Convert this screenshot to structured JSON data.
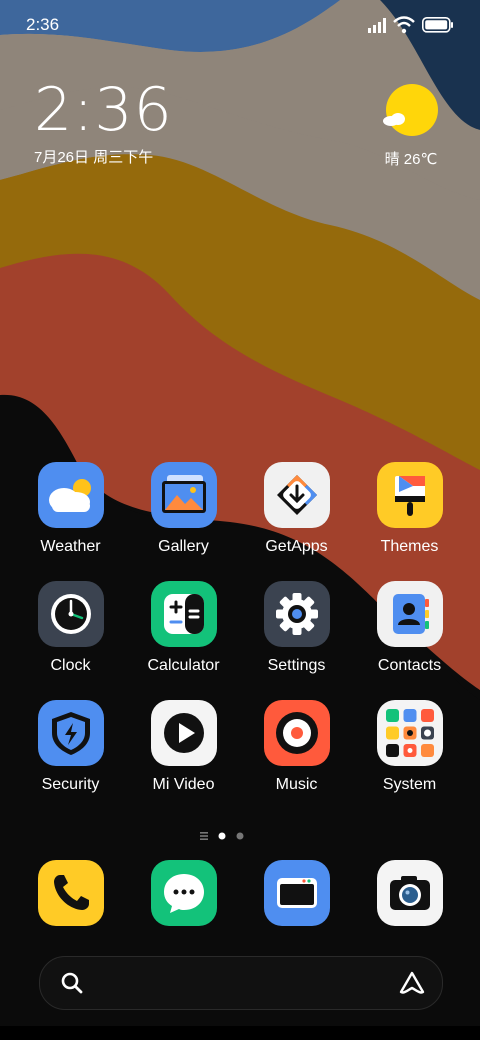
{
  "status_bar": {
    "time": "2:36",
    "icons": [
      "signal-icon",
      "wifi-icon",
      "battery-icon"
    ]
  },
  "clock_widget": {
    "time": "2:36",
    "date": "7月26日 周三下午"
  },
  "weather_widget": {
    "condition_icon": "sunny-icon",
    "text": "晴 26℃"
  },
  "apps": [
    {
      "label": "Weather",
      "icon": "weather-app-icon",
      "bg": "#4f8ef0"
    },
    {
      "label": "Gallery",
      "icon": "gallery-app-icon",
      "bg": "#4f8ef0"
    },
    {
      "label": "GetApps",
      "icon": "getapps-app-icon",
      "bg": "#f1f1f1"
    },
    {
      "label": "Themes",
      "icon": "themes-app-icon",
      "bg": "#ffcb26"
    },
    {
      "label": "Clock",
      "icon": "clock-app-icon",
      "bg": "#3b4350"
    },
    {
      "label": "Calculator",
      "icon": "calculator-app-icon",
      "bg": "#13c27a"
    },
    {
      "label": "Settings",
      "icon": "settings-app-icon",
      "bg": "#3b4350"
    },
    {
      "label": "Contacts",
      "icon": "contacts-app-icon",
      "bg": "#f1f1f1"
    },
    {
      "label": "Security",
      "icon": "security-app-icon",
      "bg": "#4f8ef0"
    },
    {
      "label": "Mi Video",
      "icon": "mivideo-app-icon",
      "bg": "#f4f4f4"
    },
    {
      "label": "Music",
      "icon": "music-app-icon",
      "bg": "#ff5a3c"
    },
    {
      "label": "System",
      "icon": "system-folder-icon",
      "bg": "#f4f4f4"
    }
  ],
  "pager": {
    "pages": 2,
    "current": 1
  },
  "dock": [
    {
      "icon": "phone-app-icon",
      "bg": "#ffcb26"
    },
    {
      "icon": "messages-app-icon",
      "bg": "#13c27a"
    },
    {
      "icon": "browser-app-icon",
      "bg": "#4f8ef0"
    },
    {
      "icon": "camera-app-icon",
      "bg": "#f4f4f4"
    }
  ],
  "search_bar": {
    "search_icon": "search-icon",
    "assistant_icon": "assistant-icon"
  }
}
